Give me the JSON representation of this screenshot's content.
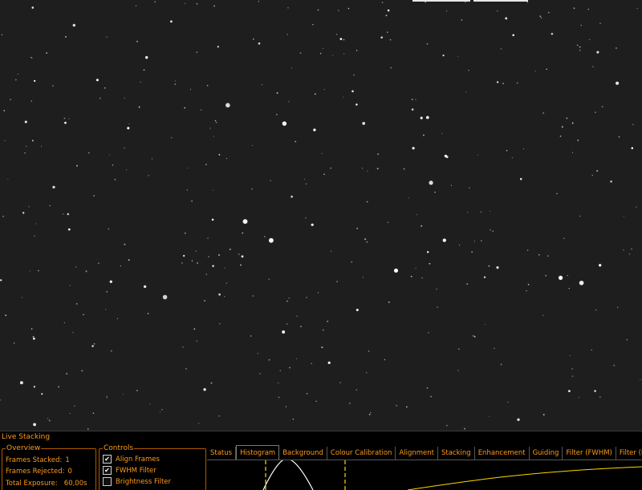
{
  "panel": {
    "title": "Live Stacking"
  },
  "overview": {
    "legend": "Overview",
    "frames_stacked_label": "Frames Stacked:",
    "frames_stacked_value": "1",
    "frames_rejected_label": "Frames Rejected:",
    "frames_rejected_value": "0",
    "total_exposure_label": "Total Exposure:",
    "total_exposure_value": "60,00s"
  },
  "controls": {
    "legend": "Controls",
    "items": [
      {
        "label": "Align Frames",
        "checked": true
      },
      {
        "label": "FWHM Filter",
        "checked": true
      },
      {
        "label": "Brightness Filter",
        "checked": false
      }
    ]
  },
  "tabs": [
    {
      "label": "Status",
      "active": false
    },
    {
      "label": "Histogram",
      "active": true
    },
    {
      "label": "Background",
      "active": false
    },
    {
      "label": "Colour Calibration",
      "active": false
    },
    {
      "label": "Alignment",
      "active": false
    },
    {
      "label": "Stacking",
      "active": false
    },
    {
      "label": "Enhancement",
      "active": false
    },
    {
      "label": "Guiding",
      "active": false
    },
    {
      "label": "Filter (FWHM)",
      "active": false
    },
    {
      "label": "Filter (Brightness)",
      "active": false
    }
  ],
  "colors": {
    "accent": "#ff9a1a",
    "group_border": "#b05a00",
    "panel_bg": "#000000",
    "sky_bg": "#1e1e1e",
    "marker": "#ffd700"
  },
  "icons": {
    "checkbox": "checkmark-icon"
  }
}
